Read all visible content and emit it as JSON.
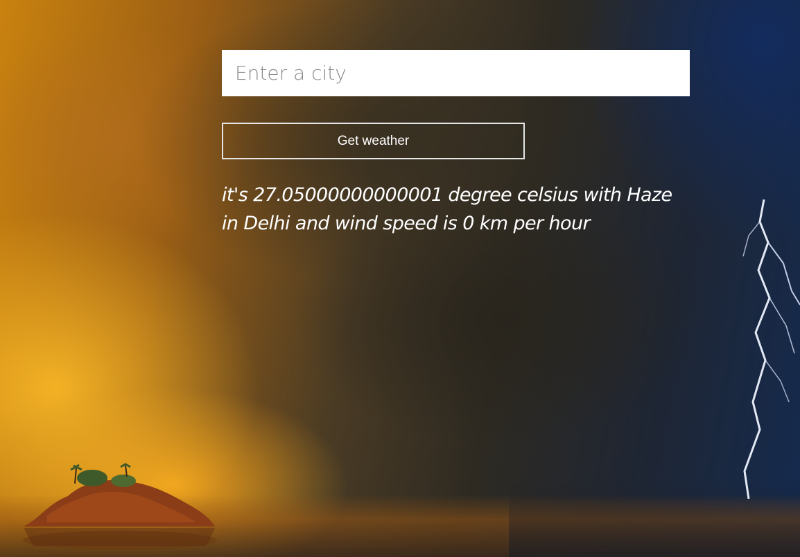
{
  "search": {
    "placeholder": "Enter a city",
    "value": ""
  },
  "button": {
    "label": "Get weather"
  },
  "result": {
    "text": "it's 27.05000000000001 degree celsius with Haze in Delhi and wind speed is 0 km per hour"
  },
  "colors": {
    "input_background": "#ffffff",
    "placeholder": "#8a8a8a",
    "button_border": "#e6e6e6",
    "text": "#ffffff"
  }
}
